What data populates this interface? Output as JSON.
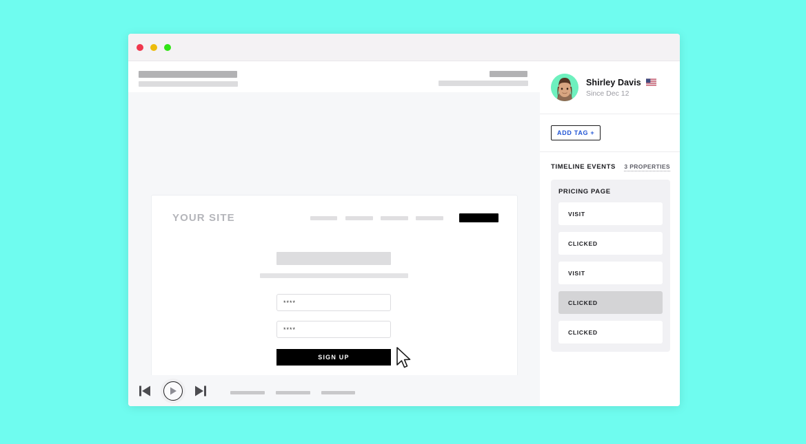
{
  "page": {
    "background_color": "#6ffcef"
  },
  "window": {
    "traffic_lights": [
      {
        "name": "close",
        "color": "#f0374d"
      },
      {
        "name": "minimize",
        "color": "#edbc0c"
      },
      {
        "name": "maximize",
        "color": "#31e416"
      }
    ]
  },
  "replay": {
    "site_card": {
      "brand": "YOUR SITE",
      "nav_placeholders": 4,
      "nav_button_label": "",
      "field_one_value": "****",
      "field_two_value": "****",
      "signup_label": "SIGN UP"
    },
    "player": {
      "prev_label": "previous-event",
      "play_label": "play",
      "next_label": "next-event",
      "progress_segments": 3
    }
  },
  "sidebar": {
    "profile": {
      "name": "Shirley Davis",
      "country_flag": "us-flag",
      "since": "Since Dec 12"
    },
    "add_tag_label": "ADD TAG +",
    "timeline": {
      "title": "TIMELINE EVENTS",
      "properties_label": "3 PROPERTIES",
      "groups": [
        {
          "title": "PRICING PAGE",
          "events": [
            {
              "label": "VISIT",
              "active": false
            },
            {
              "label": "CLICKED",
              "active": false
            },
            {
              "label": "VISIT",
              "active": false
            },
            {
              "label": "CLICKED",
              "active": true
            },
            {
              "label": "CLICKED",
              "active": false
            }
          ]
        }
      ]
    }
  },
  "colors": {
    "accent_blue": "#2255d4",
    "avatar_bg": "#6ef0be",
    "active_event_bg": "#d4d4d6",
    "panel_bg": "#f6f7f9"
  }
}
